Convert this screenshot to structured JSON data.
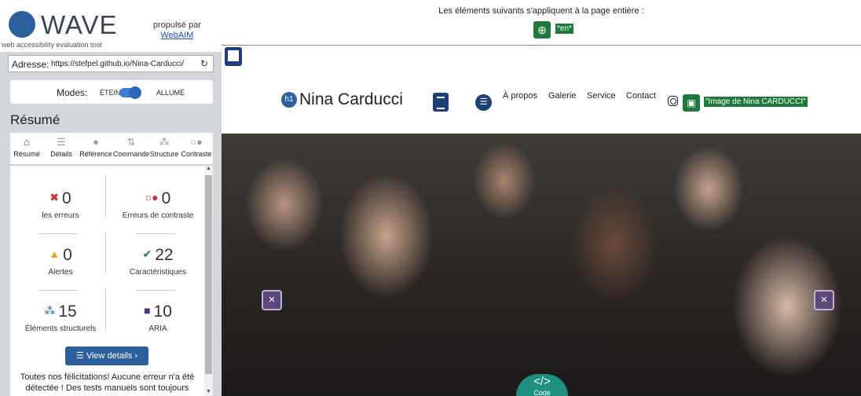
{
  "wave": {
    "logo_text": "WAVE",
    "logo_sub": "web accessibility evaluation tool",
    "powered_by": "propulsé par",
    "webaim": "WebAIM",
    "address_label": "Adresse:",
    "address_value": "https://stefpel.github.io/Nina-Carducci/",
    "modes_label": "Modes:",
    "mode_off": "ÉTEINT",
    "mode_on": "ALLUMÉ",
    "summary_heading": "Résumé",
    "tabs": [
      {
        "label": "Résumé",
        "icon": "home-icon",
        "active": true
      },
      {
        "label": "Détails",
        "icon": "list-icon"
      },
      {
        "label": "Référence",
        "icon": "info-icon"
      },
      {
        "label": "Commande",
        "icon": "order-icon"
      },
      {
        "label": "Structure",
        "icon": "structure-icon"
      },
      {
        "label": "Contraste",
        "icon": "contrast-icon"
      }
    ],
    "stats": {
      "errors": {
        "value": "0",
        "label": "les erreurs",
        "color": "#d62828"
      },
      "contrast": {
        "value": "0",
        "label": "Erreurs de contraste",
        "color": "#d62828"
      },
      "alerts": {
        "value": "0",
        "label": "Alertes",
        "color": "#e8a317"
      },
      "features": {
        "value": "22",
        "label": "Caractéristiques",
        "color": "#1e7a3a"
      },
      "structural": {
        "value": "15",
        "label": "Éléments structurels",
        "color": "#2c5f9e"
      },
      "aria": {
        "value": "10",
        "label": "ARIA",
        "color": "#5a2f8a"
      }
    },
    "view_details": "View details ›",
    "congrats": "Toutes nos félicitations! Aucune erreur n'a été détectée ! Des tests manuels sont toujours"
  },
  "page": {
    "notice": "Les éléments suivants s'appliquent à la page entière :",
    "lang_tag": "*en*",
    "site_title": "Nina Carducci",
    "h1_badge": "h1",
    "nav": [
      "À propos",
      "Galerie",
      "Service",
      "Contact"
    ],
    "img_alt": "\"Image de Nina CARDUCCI\"",
    "code_label": "Code"
  }
}
